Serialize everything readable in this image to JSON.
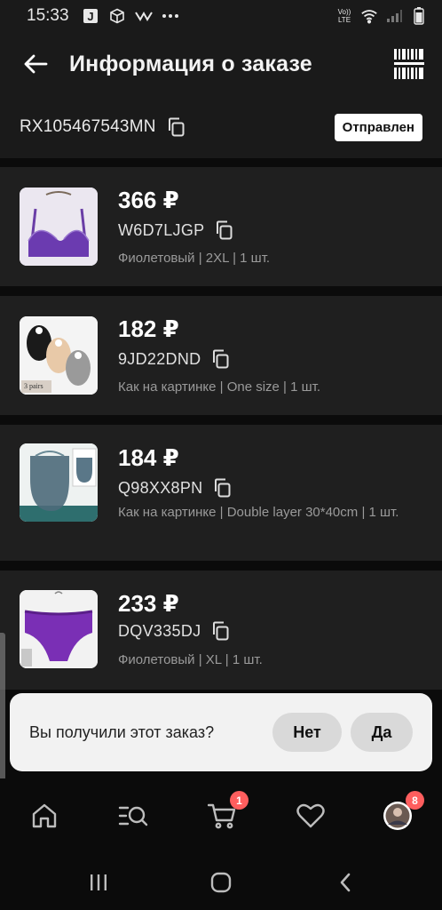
{
  "status_bar": {
    "time": "15:33",
    "network_label": "Vo)) LTE"
  },
  "header": {
    "title": "Информация о заказе"
  },
  "order": {
    "tracking_number": "RX105467543MN",
    "status": "Отправлен"
  },
  "items": [
    {
      "price": "366 ₽",
      "sku": "W6D7LJGP",
      "details": "Фиолетовый | 2XL | 1 шт."
    },
    {
      "price": "182 ₽",
      "sku": "9JD22DND",
      "details": "Как на картинке | One size | 1 шт.",
      "image_caption": "3 pairs"
    },
    {
      "price": "184 ₽",
      "sku": "Q98XX8PN",
      "details": "Как на картинке | Double layer 30*40cm | 1 шт."
    },
    {
      "price": "233 ₽",
      "sku": "DQV335DJ",
      "details": "Фиолетовый | XL | 1 шт."
    }
  ],
  "prompt": {
    "question": "Вы получили этот заказ?",
    "no_label": "Нет",
    "yes_label": "Да"
  },
  "bottom_nav": {
    "cart_badge": "1",
    "profile_badge": "8"
  },
  "colors": {
    "background": "#0b0b0b",
    "card": "#1f1f1f",
    "badge": "#ff5e5e",
    "prompt_bg": "#f2f2f2"
  }
}
